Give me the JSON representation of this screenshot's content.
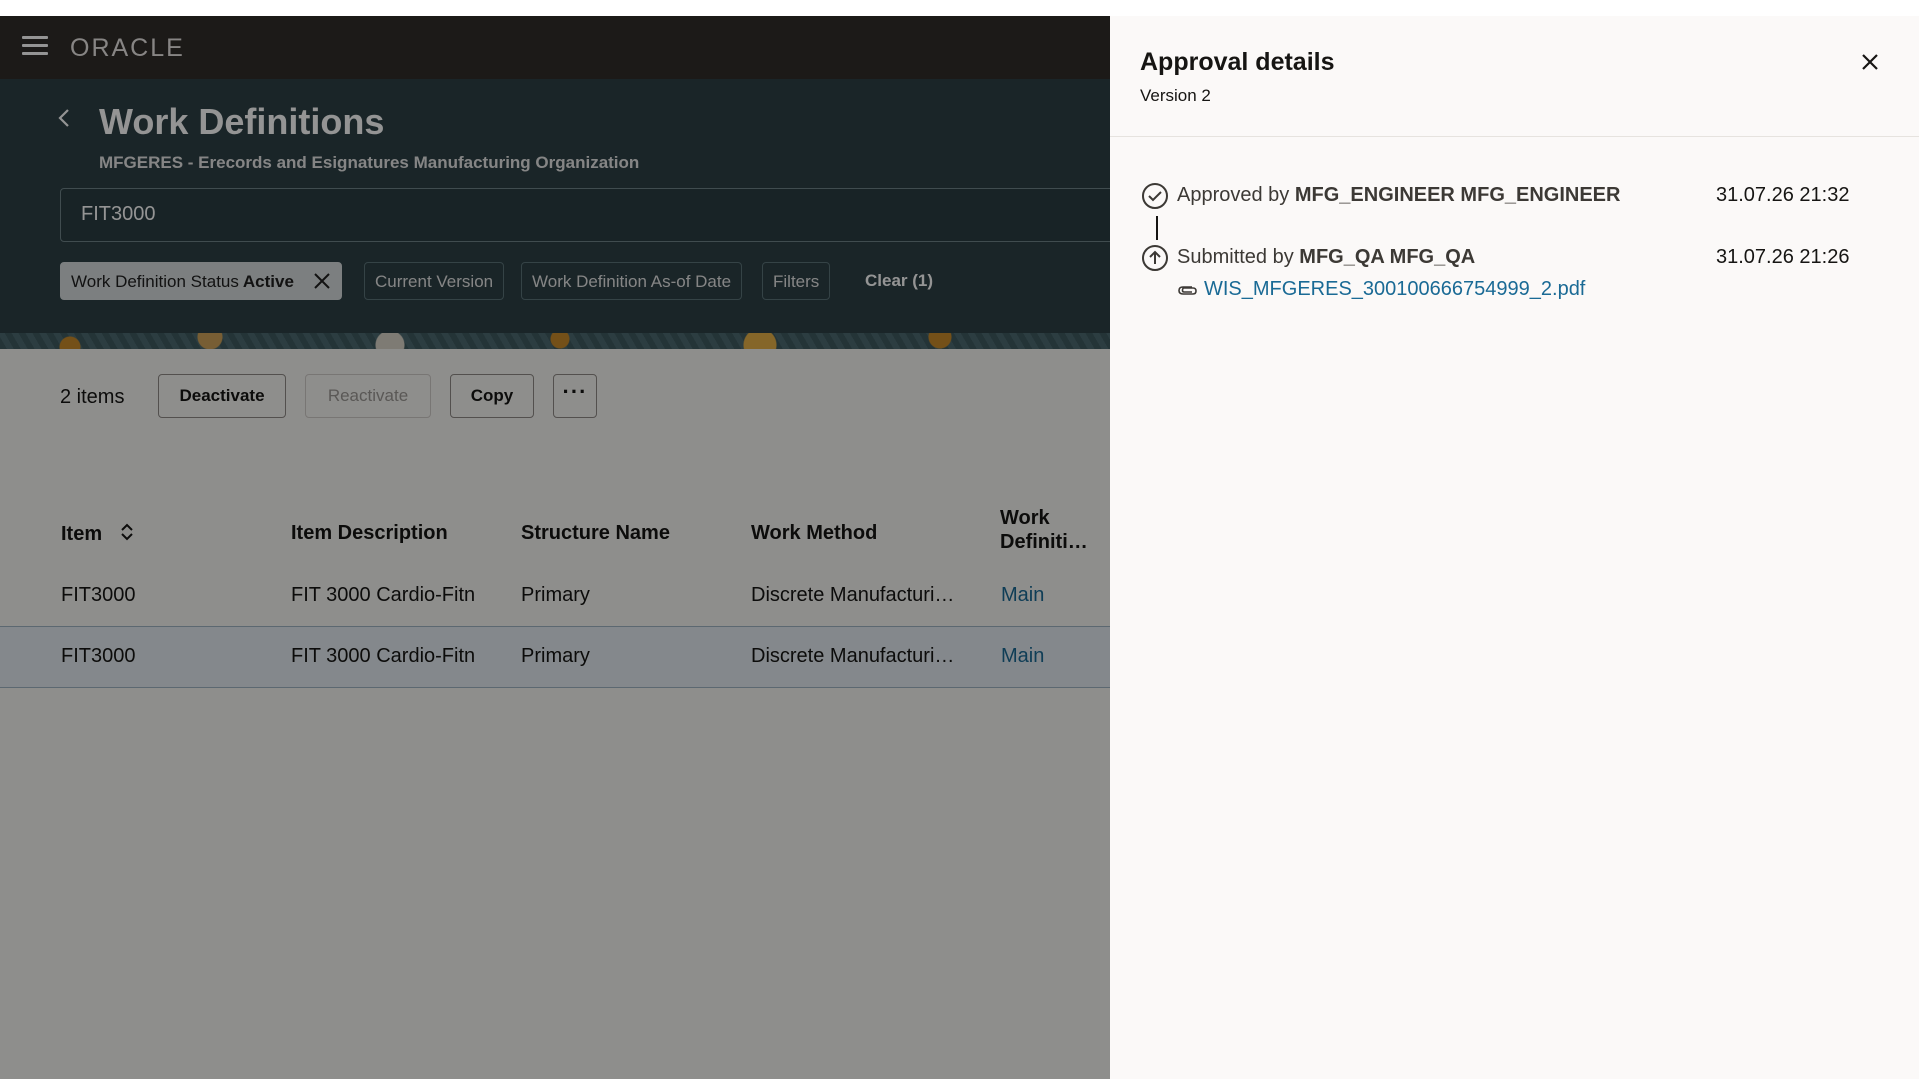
{
  "app": {
    "brand": "ORACLE"
  },
  "header": {
    "title": "Work Definitions",
    "subtitle": "MFGERES - Erecords and Esignatures Manufacturing Organization",
    "search_value": "FIT3000"
  },
  "filters": {
    "status_label": "Work Definition Status",
    "status_value": "Active",
    "current_version": "Current Version",
    "as_of_date": "Work Definition As-of Date",
    "filters": "Filters",
    "clear": "Clear (1)"
  },
  "toolbar": {
    "items_count": "2 items",
    "deactivate": "Deactivate",
    "reactivate": "Reactivate",
    "copy": "Copy",
    "more": "···"
  },
  "table": {
    "columns": [
      "Item",
      "Item Description",
      "Structure Name",
      "Work Method",
      "Work\nDefiniti…"
    ],
    "rows": [
      {
        "item": "FIT3000",
        "description": "FIT 3000 Cardio-Fitn",
        "structure": "Primary",
        "method": "Discrete Manufacturi…",
        "work_def": "Main"
      },
      {
        "item": "FIT3000",
        "description": "FIT 3000 Cardio-Fitn",
        "structure": "Primary",
        "method": "Discrete Manufacturi…",
        "work_def": "Main"
      }
    ]
  },
  "drawer": {
    "title": "Approval details",
    "subtitle": "Version 2",
    "events": [
      {
        "action": "Approved by",
        "user": "MFG_ENGINEER MFG_ENGINEER",
        "time": "31.07.26 21:32",
        "icon": "check-circle-icon"
      },
      {
        "action": "Submitted by",
        "user": "MFG_QA MFG_QA",
        "time": "31.07.26 21:26",
        "icon": "upload-circle-icon"
      }
    ],
    "attachment": "WIS_MFGERES_300100666754999_2.pdf"
  }
}
